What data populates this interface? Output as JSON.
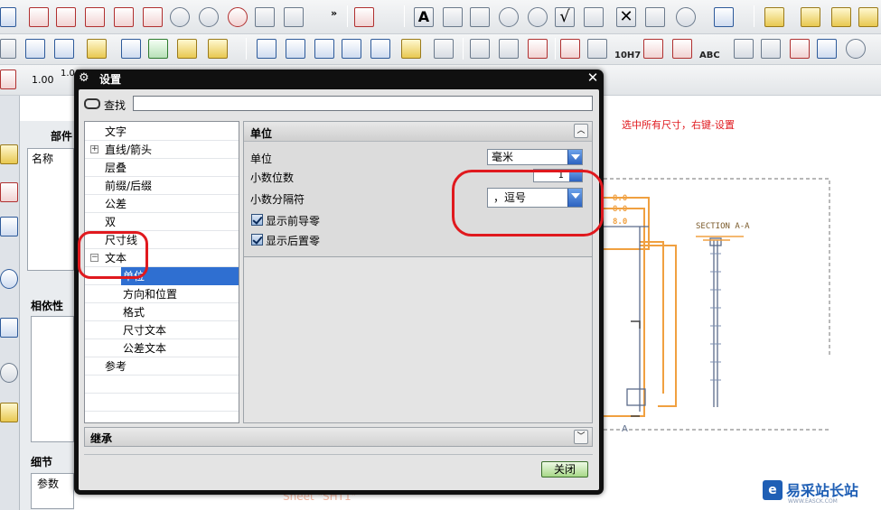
{
  "toolbar": {
    "scale_1": "1.00",
    "scale_2": "1.00",
    "h10": "10H7",
    "abc": "ABC"
  },
  "left_panel": {
    "parts_title": "部件",
    "col_name": "名称",
    "dependency_title": "相依性",
    "detail_title": "细节",
    "detail_col": "参数"
  },
  "dialog": {
    "title": "设置",
    "find_label": "查找",
    "find_value": "",
    "tree": [
      {
        "label": "文字",
        "level": 0,
        "expander": ""
      },
      {
        "label": "直线/箭头",
        "level": 0,
        "expander": "+"
      },
      {
        "label": "层叠",
        "level": 0,
        "expander": ""
      },
      {
        "label": "前缀/后缀",
        "level": 0,
        "expander": ""
      },
      {
        "label": "公差",
        "level": 0,
        "expander": ""
      },
      {
        "label": "双",
        "level": 0,
        "expander": ""
      },
      {
        "label": "尺寸线",
        "level": 0,
        "expander": ""
      },
      {
        "label": "文本",
        "level": 0,
        "expander": "−"
      },
      {
        "label": "单位",
        "level": 1,
        "expander": "",
        "selected": true
      },
      {
        "label": "方向和位置",
        "level": 1,
        "expander": ""
      },
      {
        "label": "格式",
        "level": 1,
        "expander": ""
      },
      {
        "label": "尺寸文本",
        "level": 1,
        "expander": ""
      },
      {
        "label": "公差文本",
        "level": 1,
        "expander": ""
      },
      {
        "label": "参考",
        "level": 0,
        "expander": ""
      }
    ],
    "group_title": "单位",
    "unit_label": "单位",
    "unit_value": "毫米",
    "decimals_label": "小数位数",
    "decimals_value": "1",
    "separator_label": "小数分隔符",
    "separator_value": "，逗号",
    "leading_zero_label": "显示前导零",
    "trailing_zero_label": "显示后置零",
    "inherit_label": "继承",
    "close_label": "关闭"
  },
  "drawing": {
    "annotation": "选中所有尺寸，右键-设置",
    "section_label": "SECTION A-A",
    "section_marker": "A",
    "sheet_label": "Sheet \"SHT1\""
  },
  "watermark": {
    "brand": "易采站长站",
    "url": "WWW.EASCK.COM"
  },
  "colors": {
    "highlight": "#e0191e",
    "orange": "#f0a040",
    "selection": "#2f6fd1"
  }
}
